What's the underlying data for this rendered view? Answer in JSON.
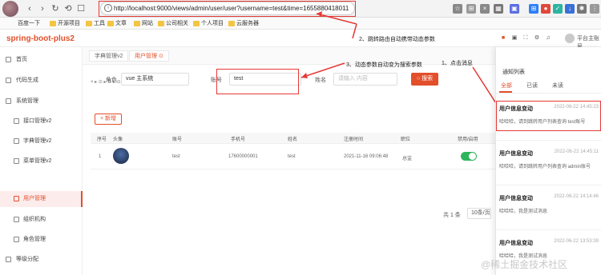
{
  "browser": {
    "url": "http://localhost:9000/views/admin/user/user?username=test&time=1655880418011",
    "nav": {
      "back": "‹",
      "forward": "›",
      "reload": "↻",
      "undo": "⟲",
      "restore": "☐"
    }
  },
  "bookmarks": [
    "百度一下",
    "开源项目",
    "工具",
    "文章",
    "网站",
    "公司相关",
    "个人项目",
    "云服务器"
  ],
  "header": {
    "brand": "spring-boot-plus2",
    "user": "平台主账号"
  },
  "sidebar": {
    "items": [
      {
        "label": "首页"
      },
      {
        "label": "代码生成"
      },
      {
        "label": "系统管理"
      },
      {
        "label": "接口管理v2"
      },
      {
        "label": "字典管理v2"
      },
      {
        "label": "菜单管理v2"
      },
      {
        "label": "用户管理"
      },
      {
        "label": "组织机构"
      },
      {
        "label": "角色管理"
      },
      {
        "label": "等级分配"
      }
    ]
  },
  "tabs": [
    {
      "label": "字典管理v2"
    },
    {
      "label": "用户管理 ⊙"
    },
    {
      "label": "× ▸ ⊙ ▸ ⊙ ▸ ⊙"
    }
  ],
  "search": {
    "role_label": "角色",
    "role_value": "vue 主系统",
    "account_label": "账号",
    "account_value": "test",
    "name_label": "姓名",
    "name_placeholder": "请输入 内容",
    "search_button": "○ 搜索"
  },
  "toolbar": {
    "add_label": "+ 新增"
  },
  "table": {
    "headers": [
      "序号",
      "头像",
      "账号",
      "手机号",
      "姓名",
      "注册时间",
      "职位",
      "禁用/启用"
    ],
    "rows": [
      {
        "index": "1",
        "account": "test",
        "phone": "17600000001",
        "name": "test",
        "registered": "2021-11-16 09:06:48",
        "position": "总监"
      }
    ]
  },
  "pagination": {
    "total": "共 1 条",
    "page_size": "10条/页"
  },
  "annotations": {
    "a1": "1、点击消息",
    "a2": "2、跳转路由自动携带动态参数",
    "a3": "3、动态参数自动变为搜索参数"
  },
  "panel": {
    "title": "通知列表",
    "tabs": [
      "全部",
      "已读",
      "未读"
    ],
    "messages": [
      {
        "title": "用户信息变动",
        "time": "2022-06-22 14:45:23",
        "body": "哈哈哈，请到跳转用户列表查询 test账号"
      },
      {
        "title": "用户信息变动",
        "time": "2022-06-22 14:45:11",
        "body": "哈哈哈，请到跳转用户列表查询 admin账号"
      },
      {
        "title": "用户信息变动",
        "time": "2022-06-22 14:14:46",
        "body": "哈哈哈，我是测试消息"
      },
      {
        "title": "用户信息变动",
        "time": "2022-06-22 13:53:39",
        "body": "哈哈哈，我是测试消息"
      }
    ]
  },
  "watermark": "@稀土掘金技术社区",
  "colors": {
    "accent": "#e34f2a",
    "annotation": "#e53935",
    "toggle_on": "#2db55d"
  }
}
